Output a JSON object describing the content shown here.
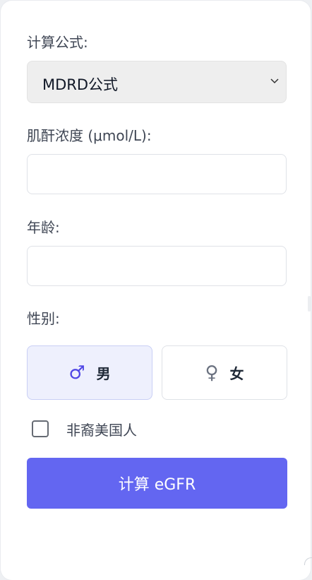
{
  "form": {
    "formula_label": "计算公式:",
    "formula_value": "MDRD公式",
    "creatinine_label": "肌酐浓度 (μmol/L):",
    "creatinine_value": "",
    "age_label": "年龄:",
    "age_value": "",
    "gender_label": "性别:",
    "gender_options": [
      {
        "label": "男",
        "icon": "male-symbol-icon",
        "selected": true
      },
      {
        "label": "女",
        "icon": "female-symbol-icon",
        "selected": false
      }
    ],
    "non_african_checkbox_label": "非裔美国人",
    "non_african_checked": false,
    "submit_label": "计算 eGFR"
  },
  "colors": {
    "primary": "#6366f1",
    "selected_bg": "#eef0fd",
    "select_bg": "#eeeeee"
  }
}
